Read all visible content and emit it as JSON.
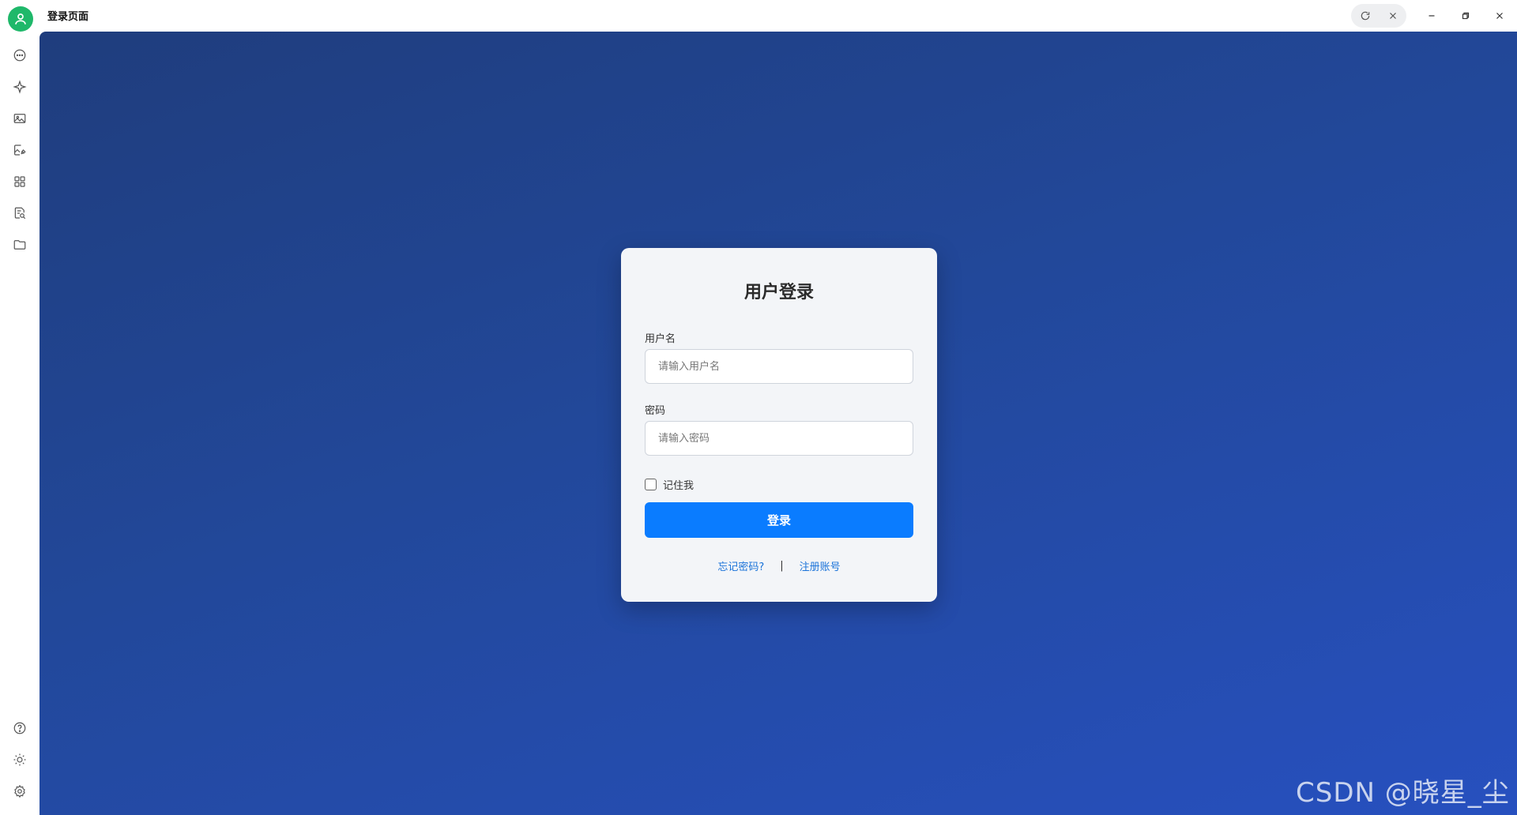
{
  "window": {
    "title": "登录页面"
  },
  "sidebar": {
    "top_icons": [
      {
        "name": "chat-icon"
      },
      {
        "name": "sparkle-icon"
      },
      {
        "name": "image-icon"
      },
      {
        "name": "image-edit-icon"
      },
      {
        "name": "grid-apps-icon"
      },
      {
        "name": "document-search-icon"
      },
      {
        "name": "folder-icon"
      }
    ],
    "bottom_icons": [
      {
        "name": "help-icon"
      },
      {
        "name": "sun-theme-icon"
      },
      {
        "name": "gear-icon"
      }
    ]
  },
  "login": {
    "title": "用户登录",
    "username_label": "用户名",
    "username_placeholder": "请输入用户名",
    "username_value": "",
    "password_label": "密码",
    "password_placeholder": "请输入密码",
    "password_value": "",
    "remember_label": "记住我",
    "remember_checked": false,
    "submit_label": "登录",
    "forgot_label": "忘记密码?",
    "separator": "|",
    "register_label": "注册账号"
  },
  "watermark": "CSDN @晓星_尘",
  "colors": {
    "accent": "#0a7cff",
    "link": "#1a73d9",
    "avatar": "#1fb86a",
    "bg_start": "#1f3d7d",
    "bg_end": "#2750bf"
  }
}
